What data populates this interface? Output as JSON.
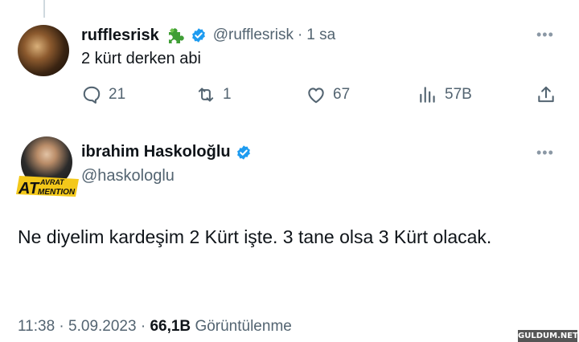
{
  "reply": {
    "name": "rufflesrisk",
    "handle": "@rufflesrisk",
    "separator": "·",
    "time": "1 sa",
    "text": "2 kürt derken abi",
    "badges": [
      "puzzle-icon",
      "verified-icon"
    ],
    "stats": {
      "replies": "21",
      "retweets": "1",
      "likes": "67",
      "views": "57B"
    }
  },
  "main": {
    "name": "ibrahim Haskoloğlu",
    "handle": "@haskologlu",
    "avatar_logo": [
      "AVRAT",
      "AT",
      "MENTION"
    ],
    "text": "Ne diyelim kardeşim 2 Kürt işte. 3 tane olsa 3 Kürt olacak.",
    "time": "11:38",
    "date": "5.09.2023",
    "views_count": "66,1B",
    "views_label": "Görüntülenme"
  },
  "more_label": "•••",
  "watermark": "GULDUM.NET",
  "colors": {
    "accent": "#1d9bf0",
    "secondary_text": "#536471",
    "primary_text": "#0f1419",
    "puzzle": "#3f9e35"
  }
}
